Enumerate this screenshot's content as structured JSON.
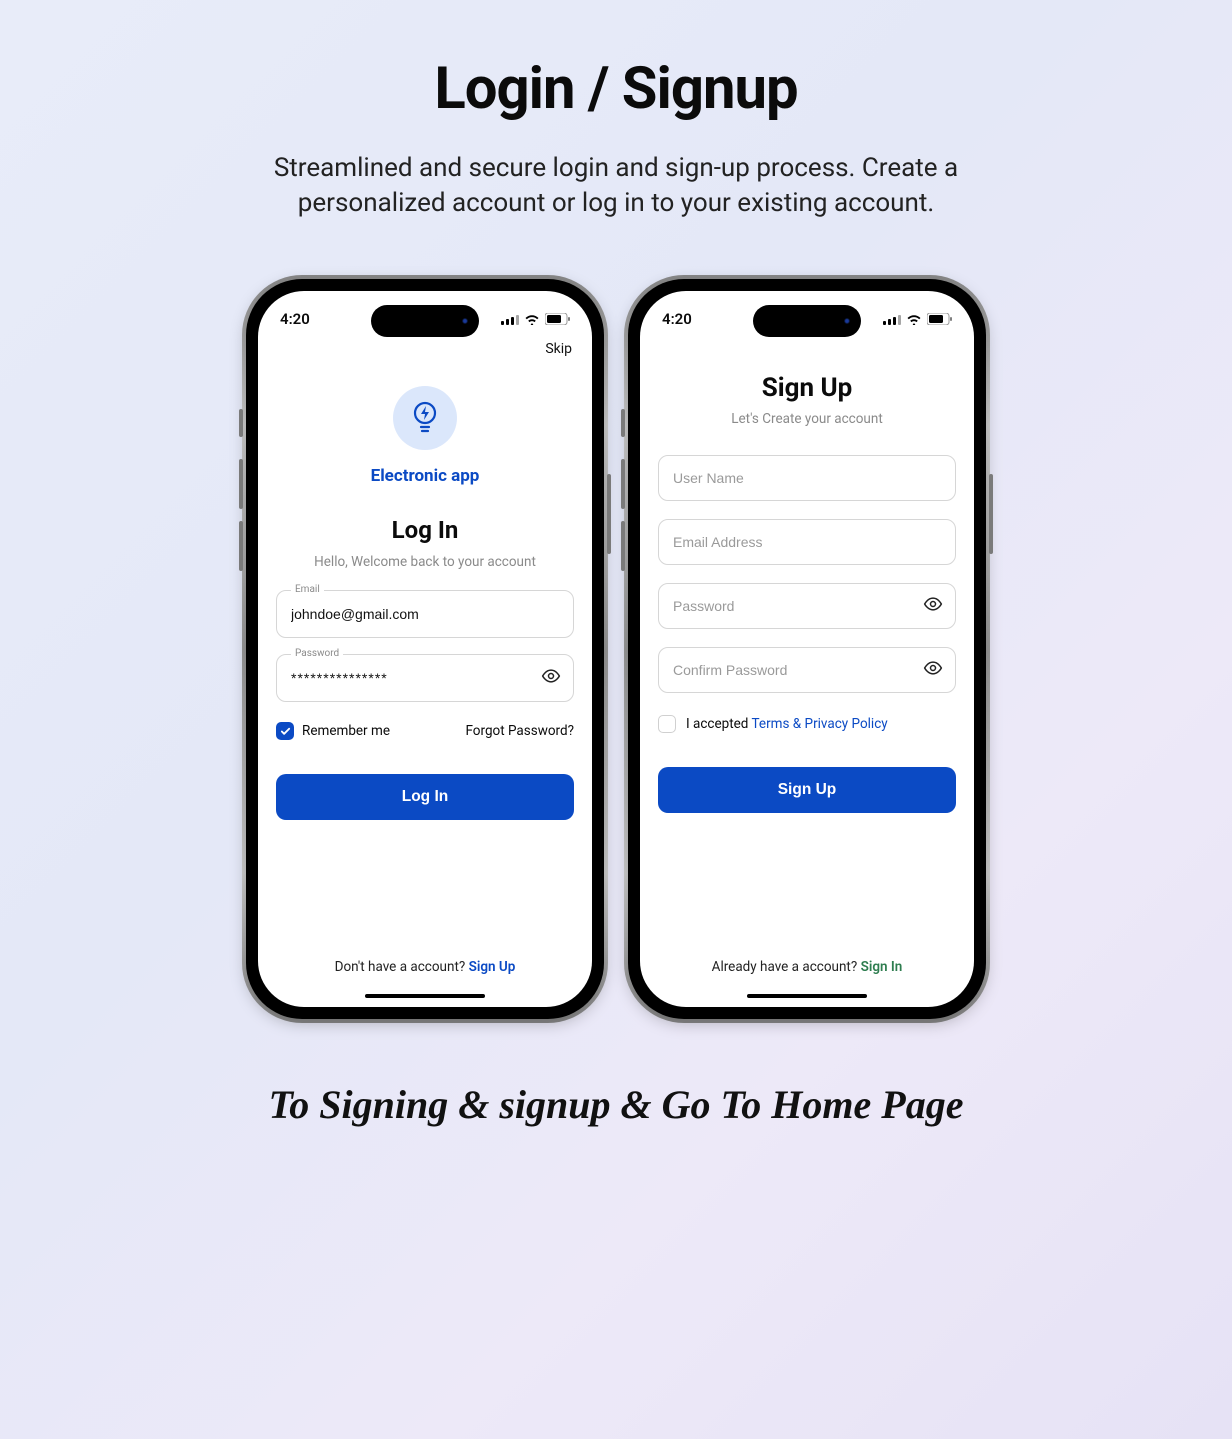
{
  "page": {
    "title": "Login / Signup",
    "subtitle": "Streamlined and secure login and sign-up process. Create a personalized account or log in to your existing account.",
    "caption": "To Signing & signup & Go To Home Page"
  },
  "status": {
    "time": "4:20"
  },
  "login": {
    "skip": "Skip",
    "appName": "Electronic app",
    "heading": "Log In",
    "sub": "Hello, Welcome back to your account",
    "emailLabel": "Email",
    "emailValue": "johndoe@gmail.com",
    "passwordLabel": "Password",
    "passwordValue": "***************",
    "remember": "Remember me",
    "forgot": "Forgot Password?",
    "button": "Log In",
    "footerText": "Don't have a account? ",
    "footerLink": "Sign Up"
  },
  "signup": {
    "heading": "Sign Up",
    "sub": "Let's Create your account",
    "usernamePh": "User Name",
    "emailPh": "Email Address",
    "passwordPh": "Password",
    "confirmPh": "Confirm Password",
    "acceptedText": "I accepted ",
    "termsLink": "Terms & Privacy Policy",
    "button": "Sign Up",
    "footerText": "Already have a account? ",
    "footerLink": "Sign In"
  }
}
